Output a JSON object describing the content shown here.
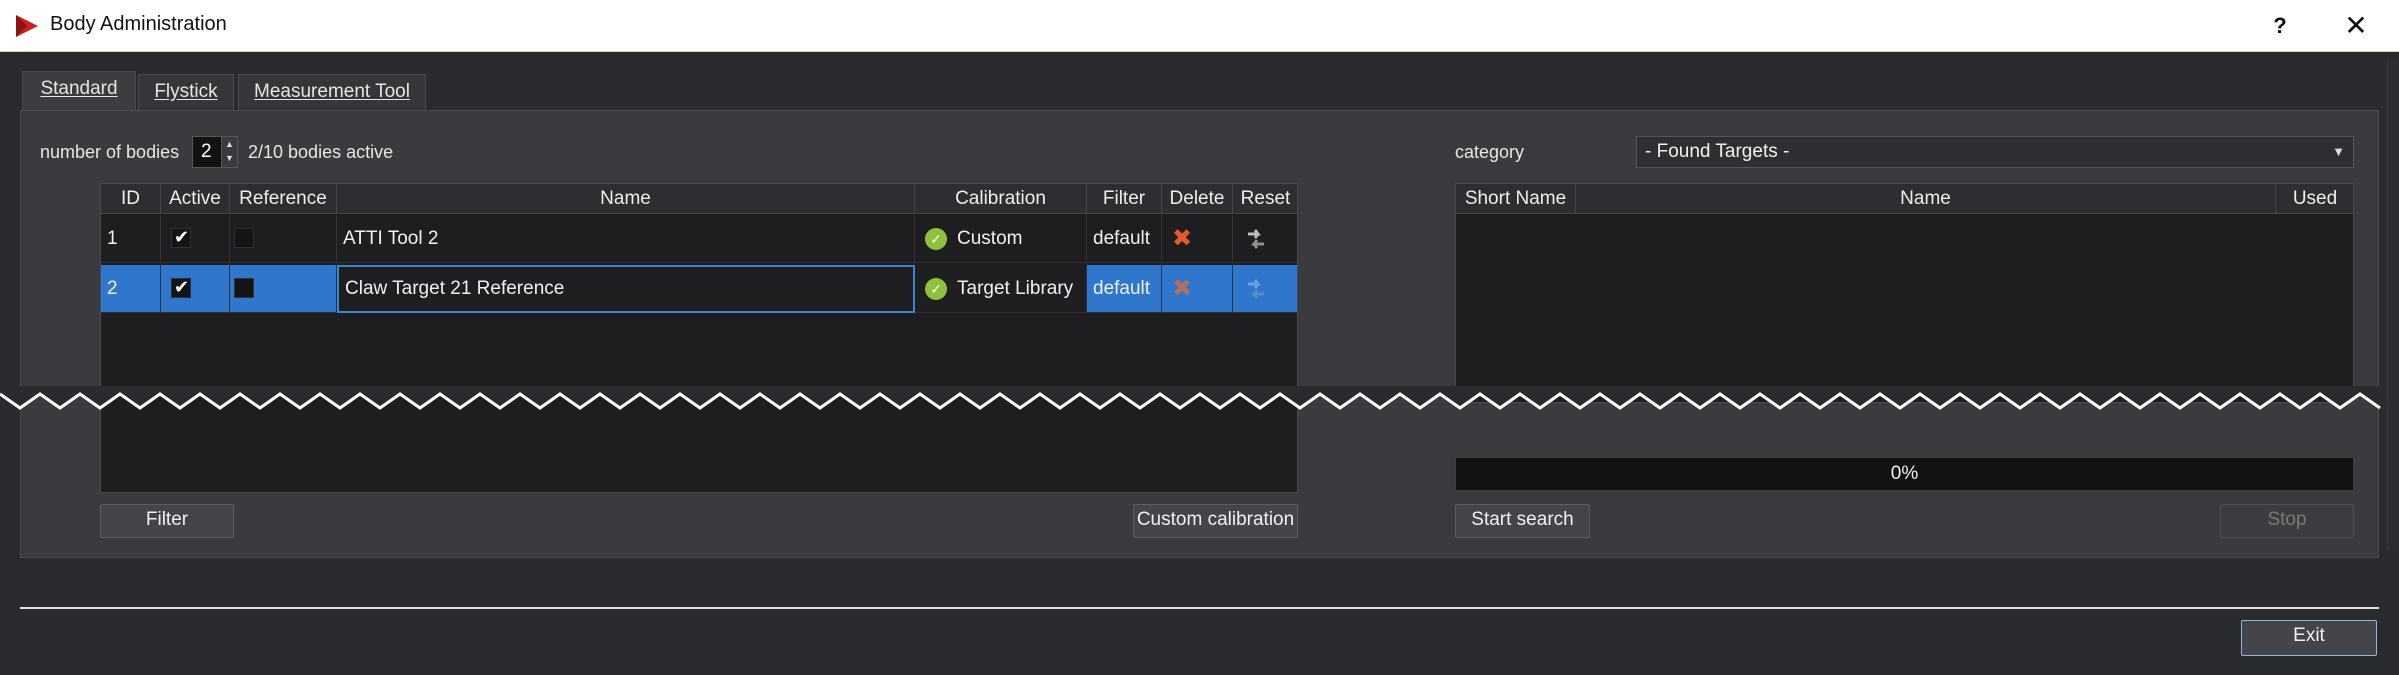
{
  "window": {
    "title": "Body Administration",
    "help_label": "?",
    "close_label": "✕"
  },
  "tabs": [
    {
      "label": "Standard"
    },
    {
      "label": "Flystick"
    },
    {
      "label": "Measurement Tool"
    }
  ],
  "bodies": {
    "label": "number of bodies",
    "value": "2",
    "status": "2/10 bodies active"
  },
  "bodies_table": {
    "columns": [
      "ID",
      "Active",
      "Reference",
      "Name",
      "Calibration",
      "Filter",
      "Delete",
      "Reset"
    ],
    "rows": [
      {
        "id": "1",
        "active": true,
        "reference": false,
        "name": "ATTI Tool 2",
        "calibration": "Custom",
        "filter": "default",
        "selected": false
      },
      {
        "id": "2",
        "active": true,
        "reference": false,
        "name": "Claw Target 21 Reference",
        "calibration": "Target Library",
        "filter": "default",
        "selected": true
      }
    ]
  },
  "left_buttons": {
    "filter": "Filter",
    "custom_calibration": "Custom calibration"
  },
  "category": {
    "label": "category",
    "selected": "- Found Targets -"
  },
  "targets_table": {
    "columns": [
      "Short Name",
      "Name",
      "Used"
    ]
  },
  "progress": {
    "text": "0%",
    "value": 0
  },
  "right_buttons": {
    "start_search": "Start search",
    "stop": "Stop"
  },
  "footer": {
    "exit": "Exit"
  },
  "colors": {
    "selection": "#2f77cc",
    "calibration_ok": "#8fc23a",
    "delete": "#e55a2a",
    "app_icon": "#cc1f1f"
  }
}
